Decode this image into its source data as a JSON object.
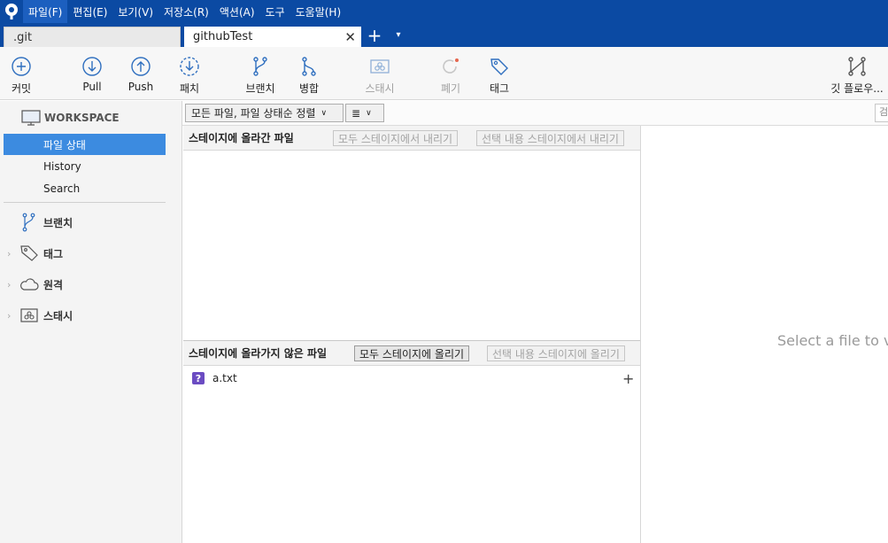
{
  "menu": {
    "items": [
      "파일(F)",
      "편집(E)",
      "보기(V)",
      "저장소(R)",
      "액션(A)",
      "도구",
      "도움말(H)"
    ]
  },
  "tabs": {
    "inactive_label": ".git",
    "active_label": "githubTest",
    "close_glyph": "✕",
    "add_glyph": "+",
    "dropdown_glyph": "▾"
  },
  "toolbar": {
    "commit": "커밋",
    "pull": "Pull",
    "push": "Push",
    "fetch": "패치",
    "branch": "브랜치",
    "merge": "병합",
    "stash": "스태시",
    "discard": "폐기",
    "tag": "태그",
    "gitflow": "깃 플로우..."
  },
  "sidebar": {
    "workspace": "WORKSPACE",
    "items": [
      "파일 상태",
      "History",
      "Search"
    ],
    "groups": [
      "브랜치",
      "태그",
      "원격",
      "스태시"
    ]
  },
  "filter": {
    "sort_label": "모든 파일, 파일 상태순 정렬",
    "view_glyph": "≣",
    "search_placeholder": "검"
  },
  "staged": {
    "title": "스테이지에 올라간 파일",
    "unstage_all": "모두 스테이지에서 내리기",
    "unstage_selected": "선택 내용 스테이지에서 내리기"
  },
  "unstaged": {
    "title": "스테이지에 올라가지 않은 파일",
    "stage_all": "모두 스테이지에 올리기",
    "stage_selected": "선택 내용 스테이지에 올리기",
    "files": [
      {
        "status": "?",
        "name": "a.txt"
      }
    ]
  },
  "preview": {
    "placeholder": "Select a file to vi"
  },
  "colors": {
    "accent": "#0b4aa3",
    "selection": "#3c8be0",
    "untracked": "#6b4cc2"
  }
}
